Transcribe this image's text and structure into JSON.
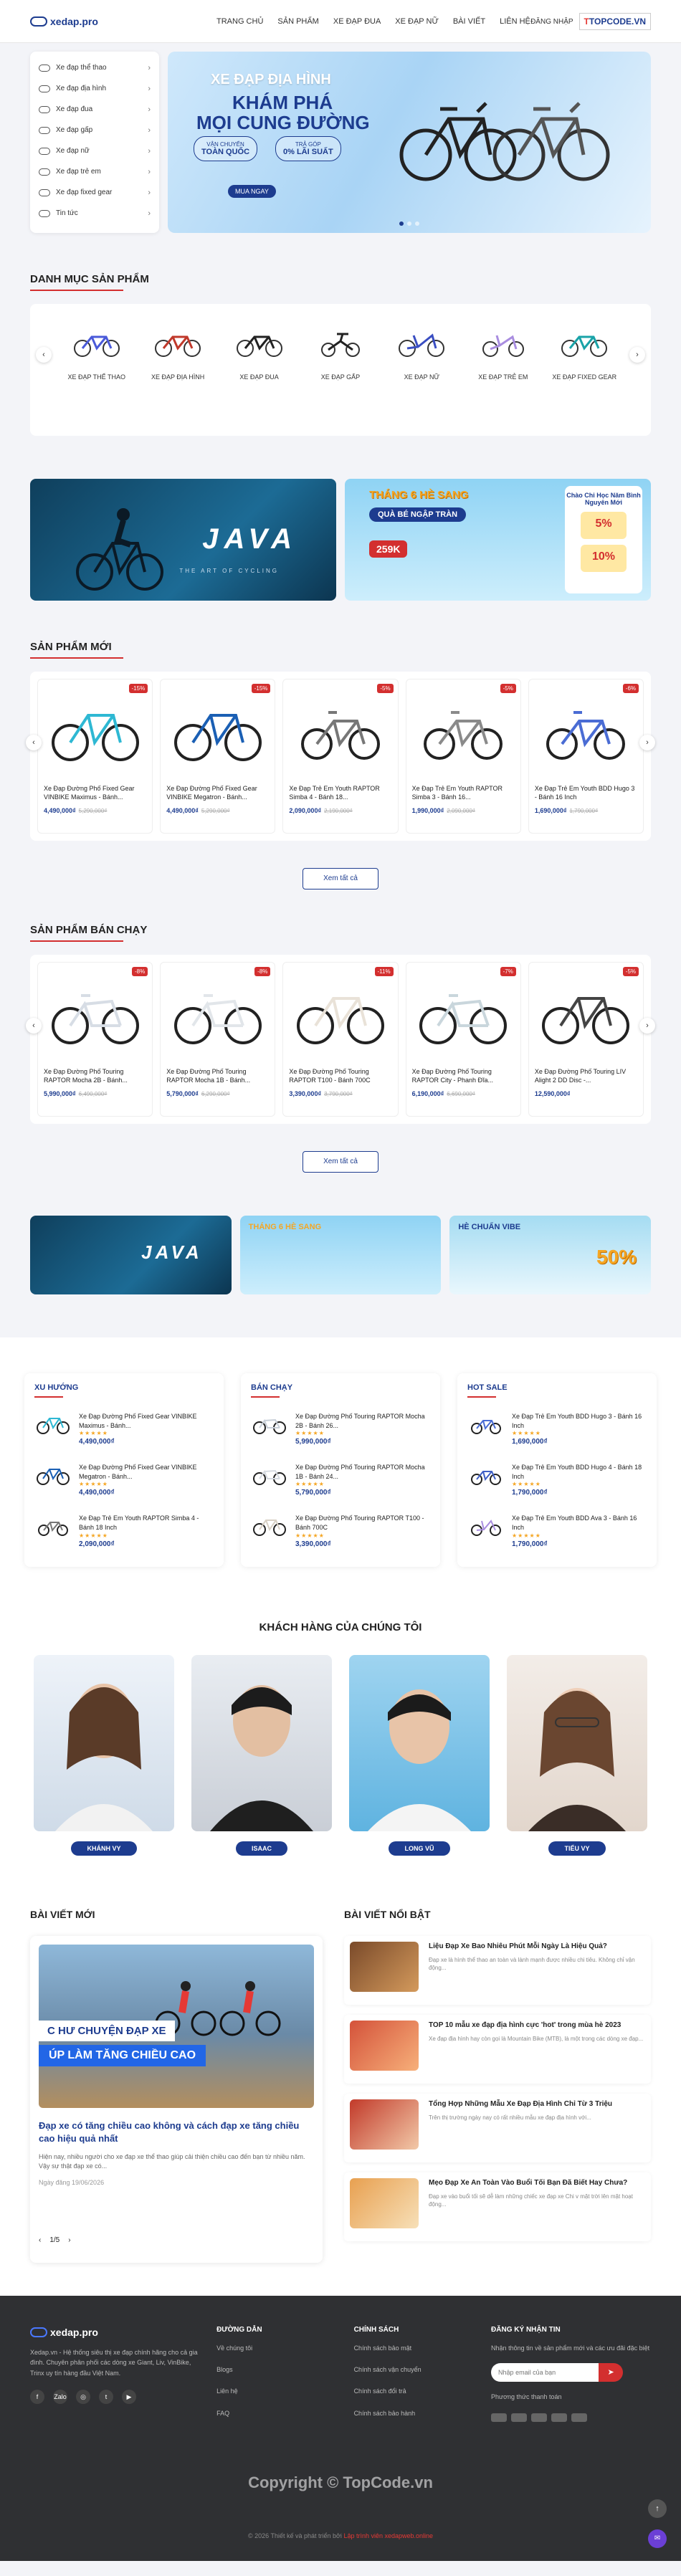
{
  "header": {
    "logo_text": "xedap.pro",
    "nav": [
      "TRANG CHỦ",
      "SẢN PHẨM",
      "XE ĐẠP ĐUA",
      "XE ĐẠP NỮ",
      "BÀI VIẾT",
      "LIÊN HỆ"
    ],
    "login": "ĐĂNG NHẬP",
    "topcode": "TOPCODE.VN"
  },
  "sidebar": {
    "items": [
      {
        "label": "Xe đạp thể thao"
      },
      {
        "label": "Xe đạp địa hình"
      },
      {
        "label": "Xe đạp đua"
      },
      {
        "label": "Xe đạp gấp"
      },
      {
        "label": "Xe đạp nữ"
      },
      {
        "label": "Xe đạp trẻ em"
      },
      {
        "label": "Xe đạp fixed gear"
      },
      {
        "label": "Tin tức"
      }
    ]
  },
  "hero": {
    "title1": "XE ĐẠP ĐỊA HÌNH",
    "title2": "KHÁM PHÁ",
    "title3": "MỌI CUNG ĐƯỜNG",
    "pill1_small": "VẬN CHUYỂN",
    "pill1": "TOÀN QUỐC",
    "pill2_small": "TRẢ GÓP",
    "pill2": "0% LÃI SUẤT",
    "cta": "MUA NGAY"
  },
  "categories": {
    "title": "DANH MỤC SẢN PHẨM",
    "items": [
      "XE ĐẠP THỂ THAO",
      "XE ĐẠP ĐỊA HÌNH",
      "XE ĐẠP ĐUA",
      "XE ĐẠP GẤP",
      "XE ĐẠP NỮ",
      "XE ĐẠP TRẺ EM",
      "XE ĐẠP FIXED GEAR"
    ]
  },
  "promo": {
    "java": "JAVA",
    "java_sub": "THE ART OF CYCLING",
    "summer1": "THÁNG 6 HÈ SANG",
    "summer2": "QUÀ BÉ NGẬP TRÀN",
    "summer_price": "259K",
    "sale_title": "Chào Chi Học Năm Bình Nguyên Mới",
    "sale1": "5%",
    "sale2": "10%",
    "new_banner": "HÈ CHUẨN VIBE",
    "new_pct": "50%"
  },
  "new_products": {
    "title": "SẢN PHẨM MỚI",
    "items": [
      {
        "name": "Xe Đạp Đường Phố Fixed Gear VINBIKE Maximus - Bánh...",
        "price": "4,490,000₫",
        "old": "5,290,000₫",
        "discount": "-15%"
      },
      {
        "name": "Xe Đạp Đường Phố Fixed Gear VINBIKE Megatron - Bánh...",
        "price": "4,490,000₫",
        "old": "5,290,000₫",
        "discount": "-15%"
      },
      {
        "name": "Xe Đạp Trẻ Em Youth RAPTOR Simba 4 - Bánh 18...",
        "price": "2,090,000₫",
        "old": "2,190,000₫",
        "discount": "-5%"
      },
      {
        "name": "Xe Đạp Trẻ Em Youth RAPTOR Simba 3 - Bánh 16...",
        "price": "1,990,000₫",
        "old": "2,090,000₫",
        "discount": "-5%"
      },
      {
        "name": "Xe Đạp Trẻ Em Youth BDD Hugo 3 - Bánh 16 Inch",
        "price": "1,690,000₫",
        "old": "1,790,000₫",
        "discount": "-6%"
      }
    ],
    "view_all": "Xem tất cả"
  },
  "best_products": {
    "title": "SẢN PHẨM BÁN CHẠY",
    "items": [
      {
        "name": "Xe Đạp Đường Phố Touring RAPTOR Mocha 2B - Bánh...",
        "price": "5,990,000₫",
        "old": "6,490,000₫",
        "discount": "-8%"
      },
      {
        "name": "Xe Đạp Đường Phố Touring RAPTOR Mocha 1B - Bánh...",
        "price": "5,790,000₫",
        "old": "6,290,000₫",
        "discount": "-8%"
      },
      {
        "name": "Xe Đạp Đường Phố Touring RAPTOR T100 - Bánh 700C",
        "price": "3,390,000₫",
        "old": "3,790,000₫",
        "discount": "-11%"
      },
      {
        "name": "Xe Đạp Đường Phố Touring RAPTOR City - Phanh Đĩa...",
        "price": "6,190,000₫",
        "old": "6,690,000₫",
        "discount": "-7%"
      },
      {
        "name": "Xe Đạp Đường Phố Touring LIV Alight 2 DD Disc -...",
        "price": "12,590,000₫",
        "old": "",
        "discount": "-5%"
      }
    ],
    "view_all": "Xem tất cả"
  },
  "lists": [
    {
      "title": "XU HƯỚNG",
      "items": [
        {
          "name": "Xe Đạp Đường Phố Fixed Gear VINBIKE Maximus - Bánh...",
          "price": "4,490,000₫"
        },
        {
          "name": "Xe Đạp Đường Phố Fixed Gear VINBIKE Megatron - Bánh...",
          "price": "4,490,000₫"
        },
        {
          "name": "Xe Đạp Trẻ Em Youth RAPTOR Simba 4 - Bánh 18 Inch",
          "price": "2,090,000₫"
        }
      ]
    },
    {
      "title": "BÁN CHẠY",
      "items": [
        {
          "name": "Xe Đạp Đường Phố Touring RAPTOR Mocha 2B - Bánh 26...",
          "price": "5,990,000₫"
        },
        {
          "name": "Xe Đạp Đường Phố Touring RAPTOR Mocha 1B - Bánh 24...",
          "price": "5,790,000₫"
        },
        {
          "name": "Xe Đạp Đường Phố Touring RAPTOR T100 - Bánh 700C",
          "price": "3,390,000₫"
        }
      ]
    },
    {
      "title": "HOT SALE",
      "items": [
        {
          "name": "Xe Đạp Trẻ Em Youth BDD Hugo 3 - Bánh 16 Inch",
          "price": "1,690,000₫"
        },
        {
          "name": "Xe Đạp Trẻ Em Youth BDD Hugo 4 - Bánh 18 Inch",
          "price": "1,790,000₫"
        },
        {
          "name": "Xe Đạp Trẻ Em Youth BDD Ava 3 - Bánh 16 Inch",
          "price": "1,790,000₫"
        }
      ]
    }
  ],
  "stars": "★★★★★",
  "customers": {
    "title": "KHÁCH HÀNG CỦA CHÚNG TÔI",
    "names": [
      "KHÁNH VY",
      "ISAAC",
      "LONG VŨ",
      "TIỂU VY"
    ]
  },
  "blog": {
    "latest_title": "BÀI VIẾT MỚI",
    "featured_title": "BÀI VIẾT NỔI BẬT",
    "big_overlay1": "C HƯ CHUYỆN ĐẠP XE",
    "big_overlay2": "ÚP LÀM TĂNG CHIỀU CAO",
    "big_title": "Đạp xe có tăng chiều cao không và cách đạp xe tăng chiều cao hiệu quả nhất",
    "big_excerpt": "Hiện nay, nhiều người cho xe đạp xe thể thao giúp cải thiện chiều cao đến bạn từ nhiều năm. Vậy sự thật đạp xe có...",
    "big_date": "Ngày đăng 19/06/2026",
    "pager": "1/5",
    "posts": [
      {
        "title": "Liệu Đạp Xe Bao Nhiêu Phút Mỗi Ngày Là Hiệu Quả?",
        "desc": "Đạp xe là hình thể thao an toàn và lành mạnh được nhiều chi tiêu. Không chỉ vận động..."
      },
      {
        "title": "TOP 10 mẫu xe đạp địa hình cực 'hot' trong mùa hè 2023",
        "desc": "Xe đạp địa hình hay còn gọi là Mountain Bike (MTB), là một trong các dòng xe đạp..."
      },
      {
        "title": "Tổng Hợp Những Mẫu Xe Đạp Địa Hình Chỉ Từ 3 Triệu",
        "desc": "Trên thị trường ngày nay có rất nhiều mẫu xe đạp địa hình với..."
      },
      {
        "title": "Mẹo Đạp Xe An Toàn Vào Buổi Tối Bạn Đã Biết Hay Chưa?",
        "desc": "Đạp xe vào buổi tối sẽ dễ làm những chiếc xe đạp xe Chi v mặt trời lên mặt hoạt động..."
      }
    ]
  },
  "footer": {
    "about_logo": "xedap.pro",
    "about": "Xedap.vn - Hệ thống siêu thị xe đạp chính hãng cho cả gia đình. Chuyên phân phối các dòng xe Giant, Liv, VinBike, Trinx uy tín hàng đầu Việt Nam.",
    "col1_title": "ĐƯỜNG DẪN",
    "col1": [
      "Về chúng tôi",
      "Blogs",
      "Liên hệ",
      "FAQ"
    ],
    "col2_title": "CHÍNH SÁCH",
    "col2": [
      "Chính sách bảo mật",
      "Chính sách vận chuyển",
      "Chính sách đổi trả",
      "Chính sách bảo hành"
    ],
    "col3_title": "ĐĂNG KÝ NHẬN TIN",
    "col3_desc": "Nhận thông tin về sản phẩm mới và các ưu đãi đặc biệt",
    "placeholder": "Nhập email của bạn",
    "payment": "Phương thức thanh toán",
    "social": [
      "f",
      "Zalo",
      "◎",
      "t",
      "▶"
    ],
    "watermark": "Copyright © TopCode.vn",
    "copyright_a": "© 2026 Thiết kế và phát triển bởi",
    "copyright_b": "Lập trình viên xedapweb.online"
  }
}
